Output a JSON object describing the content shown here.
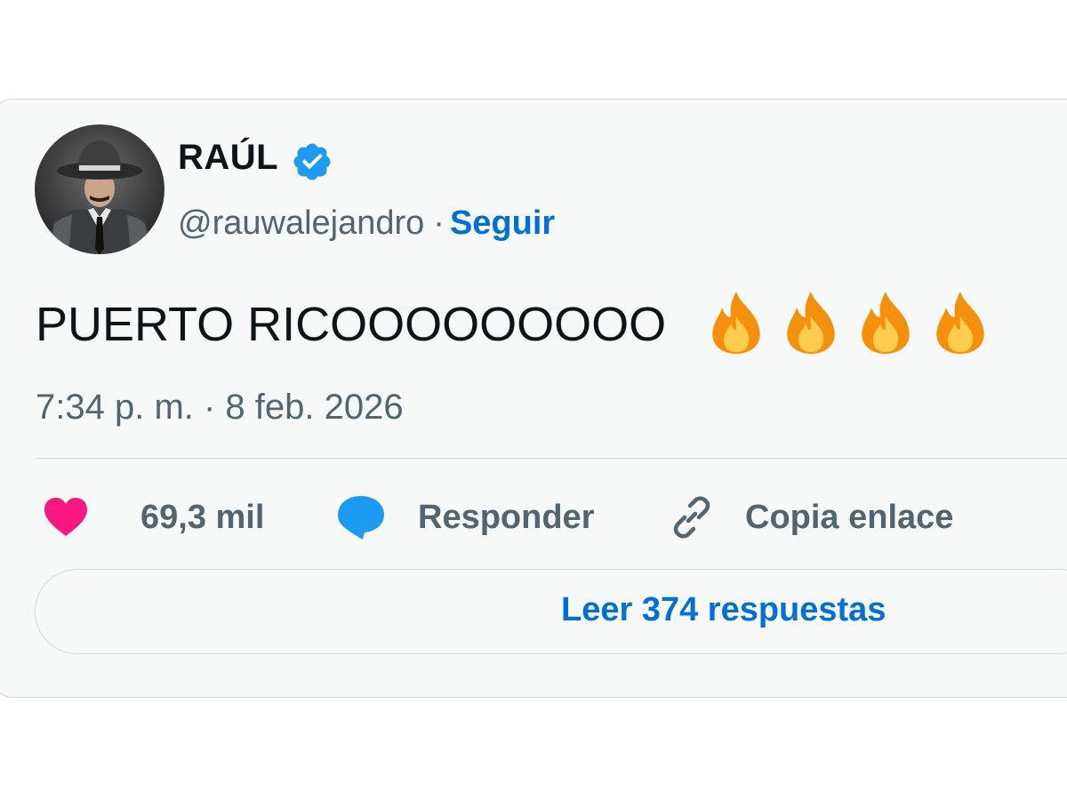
{
  "tweet": {
    "author": {
      "display_name": "RAÚL",
      "handle": "@rauwalejandro",
      "verified": true,
      "avatar": "avatar-photo-man-in-fedora"
    },
    "follow_separator": "·",
    "follow_label": "Seguir",
    "text": "PUERTO RICOOOOOOOOO",
    "emojis": [
      "fire-emoji",
      "fire-emoji",
      "fire-emoji",
      "fire-emoji"
    ],
    "timestamp": "7:34 p. m. · 8 feb. 2026"
  },
  "actions": {
    "like": {
      "icon": "heart-icon",
      "count": "69,3 mil",
      "color": "#f91880"
    },
    "reply": {
      "icon": "speech-bubble-icon",
      "label": "Responder",
      "color": "#1d9bf0"
    },
    "copy": {
      "icon": "link-icon",
      "label": "Copia enlace"
    }
  },
  "replies_button": {
    "label": "Leer 374 respuestas"
  },
  "colors": {
    "card_background": "#f7f9f9",
    "border": "#cfd9de",
    "link_blue": "#006fd6",
    "muted_text": "#536471",
    "verified_blue": "#1d9bf0"
  }
}
